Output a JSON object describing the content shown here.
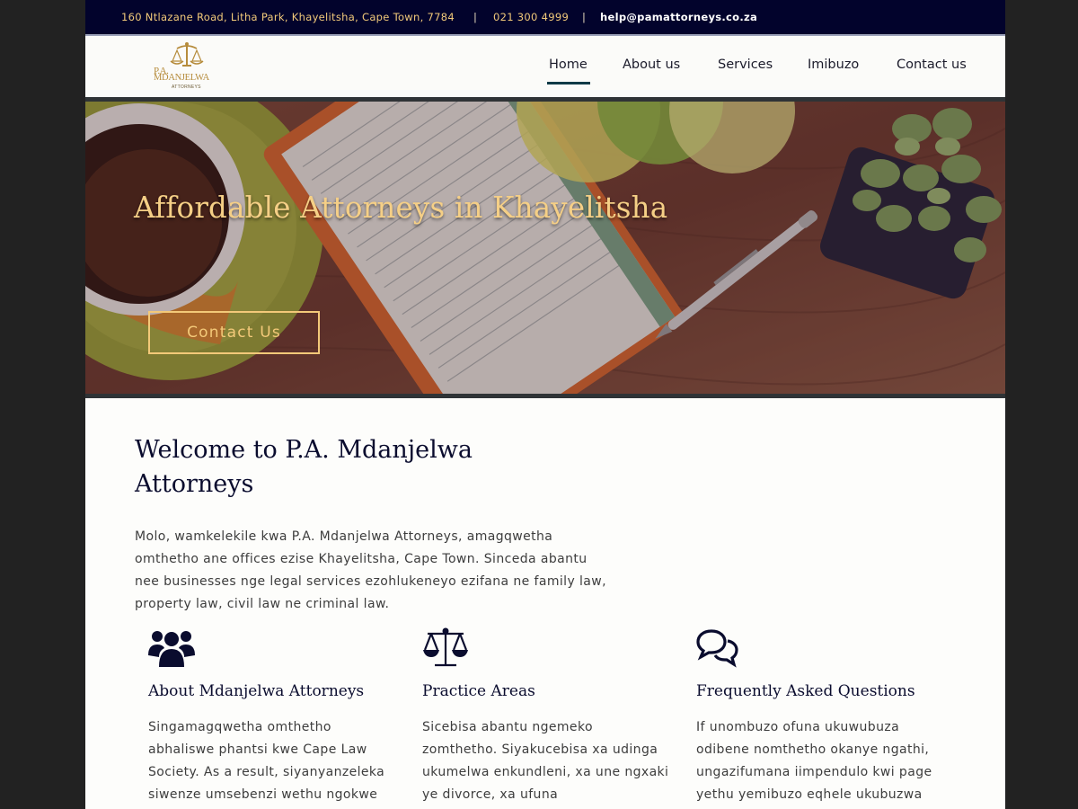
{
  "topbar": {
    "address": "160 Ntlazane Road, Litha Park, Khayelitsha, Cape Town, 7784",
    "separator": "|",
    "phone": "021 300 4999",
    "email": "help@pamattorneys.co.za"
  },
  "logo": {
    "initials": "P.A.",
    "name": "MDANJELWA",
    "sub": "ATTORNEYS"
  },
  "nav": {
    "items": [
      {
        "label": "Home",
        "active": true
      },
      {
        "label": "About us"
      },
      {
        "label": "Services"
      },
      {
        "label": "Imibuzo"
      },
      {
        "label": "Contact us"
      }
    ]
  },
  "hero": {
    "title": "Affordable Attorneys in Khayelitsha",
    "button_label": "Contact Us"
  },
  "welcome": {
    "title": "Welcome to P.A. Mdanjelwa Attorneys",
    "text": "Molo, wamkelekile kwa P.A. Mdanjelwa Attorneys, amagqwetha omthetho ane offices ezise Khayelitsha, Cape Town. Sinceda abantu nee businesses nge legal services ezohlukeneyo ezifana ne family law, property law, civil law ne criminal law."
  },
  "features": [
    {
      "icon": "users-icon",
      "title": "About Mdanjelwa Attorneys",
      "text": "Singamagqwetha omthetho abhaliswe phantsi kwe Cape Law Society. As a result, siyanyanzeleka siwenze umsebenzi wethu ngokwe"
    },
    {
      "icon": "scales-icon",
      "title": "Practice Areas",
      "text": "Sicebisa abantu ngemeko zomthetho. Siyakucebisa xa udinga ukumelwa enkundleni, xa une ngxaki ye divorce, xa ufuna"
    },
    {
      "icon": "chat-bubbles-icon",
      "title": "Frequently Asked Questions",
      "text": "If unombuzo ofuna ukuwubuza odibene nomthetho okanye ngathi, ungazifumana iimpendulo kwi page yethu yemibuzo eqhele ukubuzwa"
    }
  ],
  "colors": {
    "navy": "#02032c",
    "gold": "#f3c979",
    "active_underline": "#0e3a47"
  }
}
